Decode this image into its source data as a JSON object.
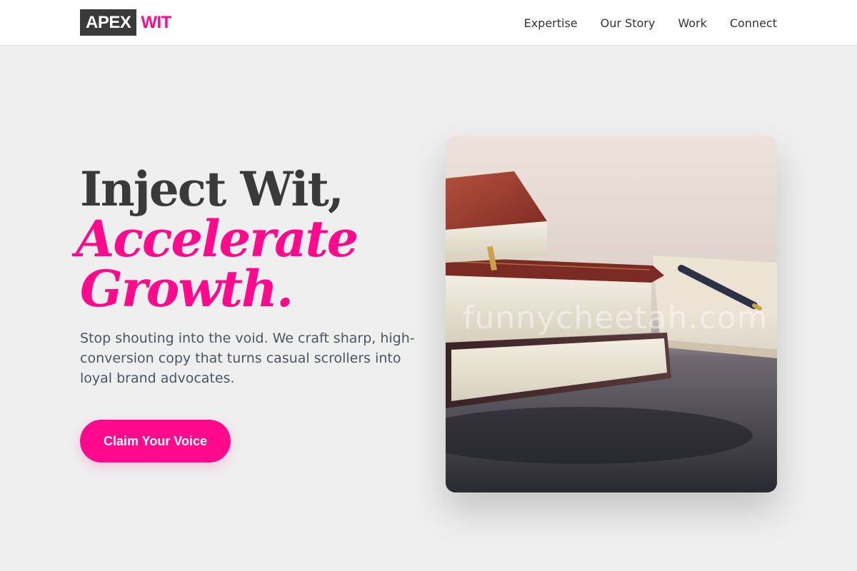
{
  "header": {
    "logo_dark": "APEX",
    "logo_accent": "WIT",
    "nav": [
      {
        "label": "Expertise"
      },
      {
        "label": "Our Story"
      },
      {
        "label": "Work"
      },
      {
        "label": "Connect"
      }
    ]
  },
  "hero": {
    "headline_line1": "Inject Wit,",
    "headline_line2": "Accelerate",
    "headline_line3": "Growth.",
    "lead": "Stop shouting into the void. We craft sharp, high-conversion copy that turns casual scrollers into loyal brand advocates.",
    "cta_label": "Claim Your Voice",
    "image_watermark": "funnycheetah.com"
  },
  "colors": {
    "accent": "#ff0a8c",
    "dark": "#3a3a3a",
    "page_background": "#efefef",
    "header_background": "#ffffff"
  },
  "icons": {
    "hero_image": "stacked-books-photo"
  }
}
